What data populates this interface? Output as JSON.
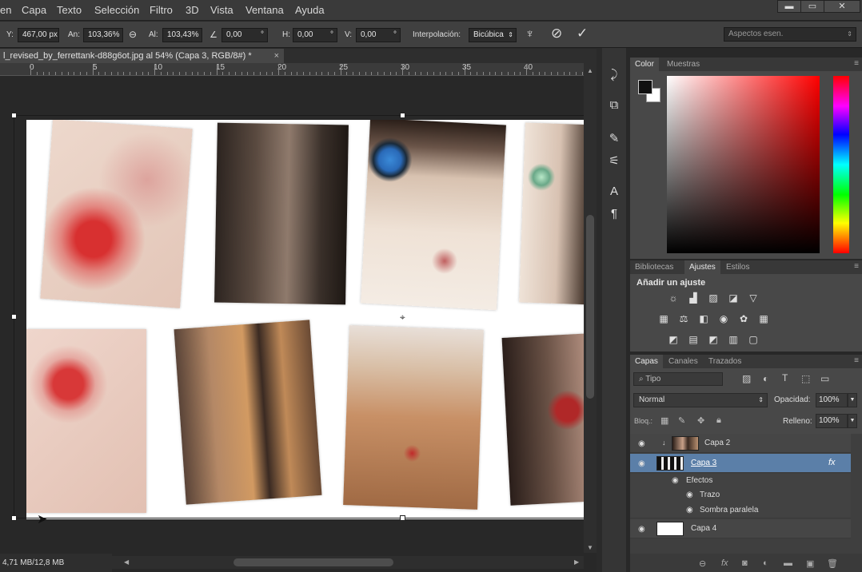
{
  "menu": [
    "en",
    "Capa",
    "Texto",
    "Selección",
    "Filtro",
    "3D",
    "Vista",
    "Ventana",
    "Ayuda"
  ],
  "window_buttons": [
    "▬",
    "▭",
    "✕"
  ],
  "options": {
    "y_label": "Y:",
    "y_value": "467,00 px",
    "an_label": "An:",
    "an_value": "103,36%",
    "al_label": "Al:",
    "al_value": "103,43%",
    "angle_value": "0,00",
    "angle_unit": "°",
    "h_label": "H:",
    "h_value": "0,00",
    "h_unit": "°",
    "v_label": "V:",
    "v_value": "0,00",
    "v_unit": "°",
    "interp_label": "Interpolación:",
    "interp_value": "Bicúbica",
    "workspace": "Aspectos esen."
  },
  "document": {
    "tab_title": "l_revised_by_ferrettank-d88g6ot.jpg al 54% (Capa 3, RGB/8#) *",
    "close": "×",
    "ruler_labels": [
      "0",
      "5",
      "10",
      "15",
      "20",
      "25",
      "30",
      "35",
      "40"
    ],
    "status": "4,71 MB/12,8 MB"
  },
  "color_panel": {
    "tabs": [
      "Color",
      "Muestras"
    ]
  },
  "adjust_panel": {
    "tabs": [
      "Bibliotecas",
      "Ajustes",
      "Estilos"
    ],
    "heading": "Añadir un ajuste"
  },
  "layers_panel": {
    "tabs": [
      "Capas",
      "Canales",
      "Trazados"
    ],
    "filter": "Tipo",
    "blend_mode": "Normal",
    "opacity_label": "Opacidad:",
    "opacity_value": "100%",
    "lock_label": "Bloq.:",
    "fill_label": "Relleno:",
    "fill_value": "100%",
    "layers": [
      {
        "name": "Capa 2"
      },
      {
        "name": "Capa 3",
        "fx": "fx"
      },
      {
        "name": "Efectos"
      },
      {
        "name": "Trazo"
      },
      {
        "name": "Sombra paralela"
      },
      {
        "name": "Capa 4"
      }
    ]
  },
  "colors": {
    "accent_selected_layer": "#5b7fa8",
    "foreground": "#111111",
    "background": "#ffffff"
  }
}
